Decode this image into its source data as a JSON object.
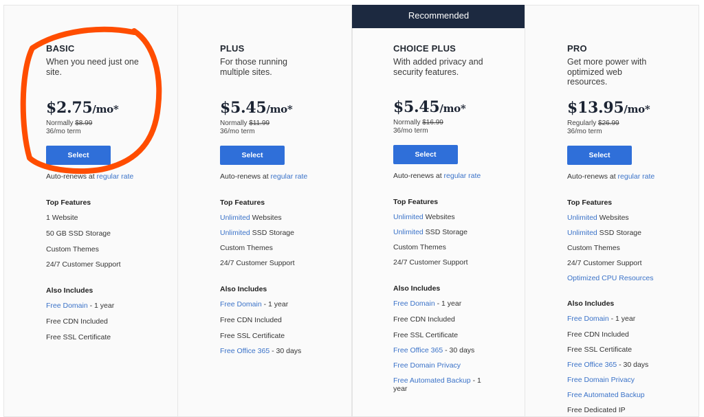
{
  "colors": {
    "accent": "#2f6fd9",
    "link": "#3a72c8",
    "banner_bg": "#1c2940",
    "annotation": "#ff4d00"
  },
  "recommended_label": "Recommended",
  "select_label": "Select",
  "autorenew": {
    "prefix": "Auto-renews at ",
    "link": "regular rate"
  },
  "top_features_label": "Top Features",
  "also_includes_label": "Also Includes",
  "plans": [
    {
      "name": "BASIC",
      "desc": "When you need just one site.",
      "price": "$2.75",
      "per": "/mo*",
      "normally_label": "Normally",
      "normal_price": "$8.99",
      "term": "36/mo term",
      "top_features": [
        {
          "link": "",
          "text": "1 Website"
        },
        {
          "link": "",
          "text": "50 GB SSD Storage"
        },
        {
          "link": "",
          "text": "Custom Themes"
        },
        {
          "link": "",
          "text": "24/7 Customer Support"
        }
      ],
      "also_includes": [
        {
          "link": "Free Domain",
          "text": " - 1 year"
        },
        {
          "link": "",
          "text": "Free CDN Included"
        },
        {
          "link": "",
          "text": "Free SSL Certificate"
        }
      ]
    },
    {
      "name": "PLUS",
      "desc": "For those running multiple sites.",
      "price": "$5.45",
      "per": "/mo*",
      "normally_label": "Normally",
      "normal_price": "$11.99",
      "term": "36/mo term",
      "top_features": [
        {
          "link": "Unlimited",
          "text": " Websites"
        },
        {
          "link": "Unlimited",
          "text": " SSD Storage"
        },
        {
          "link": "",
          "text": "Custom Themes"
        },
        {
          "link": "",
          "text": "24/7 Customer Support"
        }
      ],
      "also_includes": [
        {
          "link": "Free Domain",
          "text": " - 1 year"
        },
        {
          "link": "",
          "text": "Free CDN Included"
        },
        {
          "link": "",
          "text": "Free SSL Certificate"
        },
        {
          "link": "Free Office 365",
          "text": " - 30 days"
        }
      ]
    },
    {
      "name": "CHOICE PLUS",
      "desc": "With added privacy and security features.",
      "price": "$5.45",
      "per": "/mo*",
      "normally_label": "Normally",
      "normal_price": "$16.99",
      "term": "36/mo term",
      "recommended": true,
      "top_features": [
        {
          "link": "Unlimited",
          "text": " Websites"
        },
        {
          "link": "Unlimited",
          "text": " SSD Storage"
        },
        {
          "link": "",
          "text": "Custom Themes"
        },
        {
          "link": "",
          "text": "24/7 Customer Support"
        }
      ],
      "also_includes": [
        {
          "link": "Free Domain",
          "text": " - 1 year"
        },
        {
          "link": "",
          "text": "Free CDN Included"
        },
        {
          "link": "",
          "text": "Free SSL Certificate"
        },
        {
          "link": "Free Office 365",
          "text": " - 30 days"
        },
        {
          "link": "Free Domain Privacy",
          "text": ""
        },
        {
          "link": "Free Automated Backup",
          "text": " - 1 year"
        }
      ]
    },
    {
      "name": "PRO",
      "desc": "Get more power with optimized web resources.",
      "price": "$13.95",
      "per": "/mo*",
      "normally_label": "Regularly",
      "normal_price": "$26.99",
      "term": "36/mo term",
      "top_features": [
        {
          "link": "Unlimited",
          "text": " Websites"
        },
        {
          "link": "Unlimited",
          "text": " SSD Storage"
        },
        {
          "link": "",
          "text": "Custom Themes"
        },
        {
          "link": "",
          "text": "24/7 Customer Support"
        },
        {
          "link": "Optimized CPU Resources",
          "text": ""
        }
      ],
      "also_includes": [
        {
          "link": "Free Domain",
          "text": " - 1 year"
        },
        {
          "link": "",
          "text": "Free CDN Included"
        },
        {
          "link": "",
          "text": "Free SSL Certificate"
        },
        {
          "link": "Free Office 365",
          "text": " - 30 days"
        },
        {
          "link": "Free Domain Privacy",
          "text": ""
        },
        {
          "link": "Free Automated Backup",
          "text": ""
        },
        {
          "link": "",
          "text": "Free Dedicated IP"
        }
      ]
    }
  ]
}
